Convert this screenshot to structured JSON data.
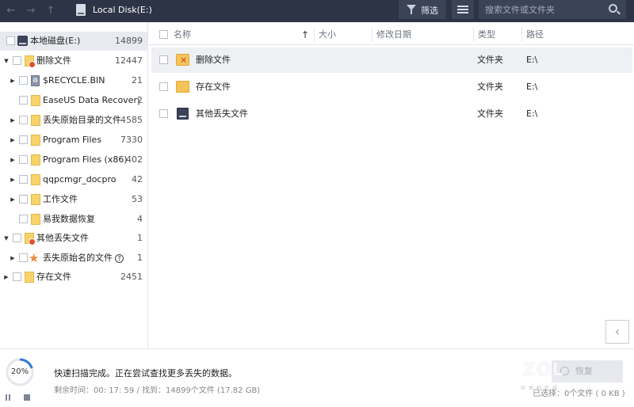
{
  "titlebar": {
    "title": "Local Disk(E:)",
    "filter_label": "筛选",
    "search_placeholder": "搜索文件或文件夹"
  },
  "tree": [
    {
      "label": "本地磁盘(E:)",
      "count": "14899",
      "icon": "disk-icon"
    },
    {
      "label": "删除文件",
      "count": "12447",
      "icon": "deleted-folder-icon"
    },
    {
      "label": "$RECYCLE.BIN",
      "count": "21",
      "icon": "recycle-bin-icon"
    },
    {
      "label": "EaseUS Data Recovery ...",
      "count": "2",
      "icon": "folder-icon"
    },
    {
      "label": "丢失原始目录的文件",
      "count": "4585",
      "icon": "folder-icon"
    },
    {
      "label": "Program Files",
      "count": "7330",
      "icon": "folder-icon"
    },
    {
      "label": "Program Files (x86)",
      "count": "402",
      "icon": "folder-icon"
    },
    {
      "label": "qqpcmgr_docpro",
      "count": "42",
      "icon": "folder-icon"
    },
    {
      "label": "工作文件",
      "count": "53",
      "icon": "folder-icon"
    },
    {
      "label": "易我数据恢复",
      "count": "4",
      "icon": "folder-icon"
    },
    {
      "label": "其他丢失文件",
      "count": "1",
      "icon": "lost-folder-icon"
    },
    {
      "label": "丢失原始名的文件",
      "count": "1",
      "icon": "star-icon"
    },
    {
      "label": "存在文件",
      "count": "2451",
      "icon": "folder-icon"
    }
  ],
  "list": {
    "columns": {
      "name": "名称",
      "size": "大小",
      "modified": "修改日期",
      "type": "类型",
      "path": "路径"
    },
    "rows": [
      {
        "name": "删除文件",
        "type": "文件夹",
        "path": "E:\\",
        "icon": "deleted-folder-icon"
      },
      {
        "name": "存在文件",
        "type": "文件夹",
        "path": "E:\\",
        "icon": "folder-icon"
      },
      {
        "name": "其他丢失文件",
        "type": "文件夹",
        "path": "E:\\",
        "icon": "lost-files-icon"
      }
    ]
  },
  "status": {
    "progress_percent": "20%",
    "progress_value": 0.2,
    "main_text": "快速扫描完成。正在尝试查找更多丢失的数据。",
    "sub_text": "剩余时间：00: 17: 59 / 找到：14899个文件 (17.82 GB)",
    "recover_label": "恢复",
    "selected_info": "已选择：0个文件 ( 0 KB )"
  },
  "watermark": {
    "brand": "ZOL",
    "sub": "中关村在线"
  },
  "colors": {
    "titlebar": "#2d3446",
    "folder": "#f5c35a",
    "progress": "#2f7ad8"
  }
}
